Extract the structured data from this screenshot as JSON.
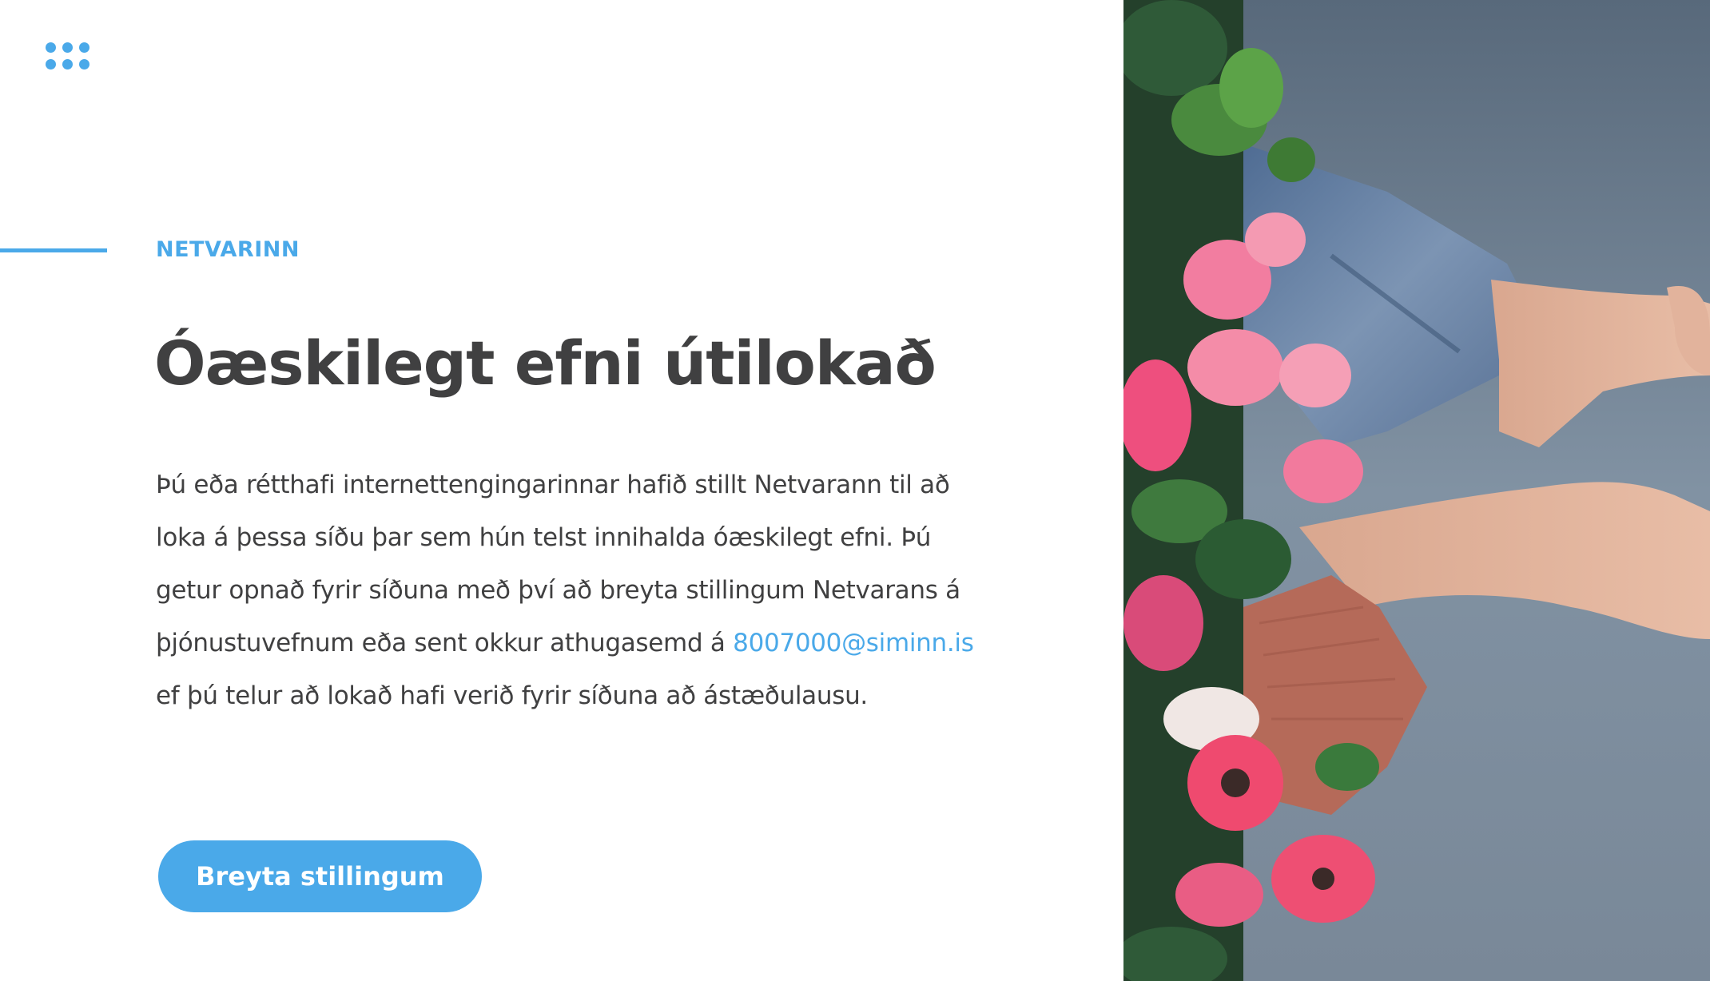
{
  "logo": {
    "icon": "six-dot-grid-icon",
    "color": "#4aa9e9"
  },
  "hero": {
    "eyebrow": "NETVARINN",
    "title": "Óæskilegt efni útilokað",
    "body_before_link": "Þú eða rétthafi internettengingarinnar hafið stillt Netvarann til að loka á þessa síðu þar sem hún telst innihalda óæskilegt efni. Þú getur opnað fyrir síðuna með því að breyta stillingum Netvarans á þjónustuvefnum eða sent okkur athugasemd á ",
    "email_link": "8007000@siminn.is",
    "body_after_link": " ef þú telur að lokað hafi verið fyrir síðuna að ástæðulausu.",
    "button_label": "Breyta stillingum"
  },
  "colors": {
    "accent": "#4aa9e9",
    "text": "#404041",
    "background": "#ffffff"
  }
}
